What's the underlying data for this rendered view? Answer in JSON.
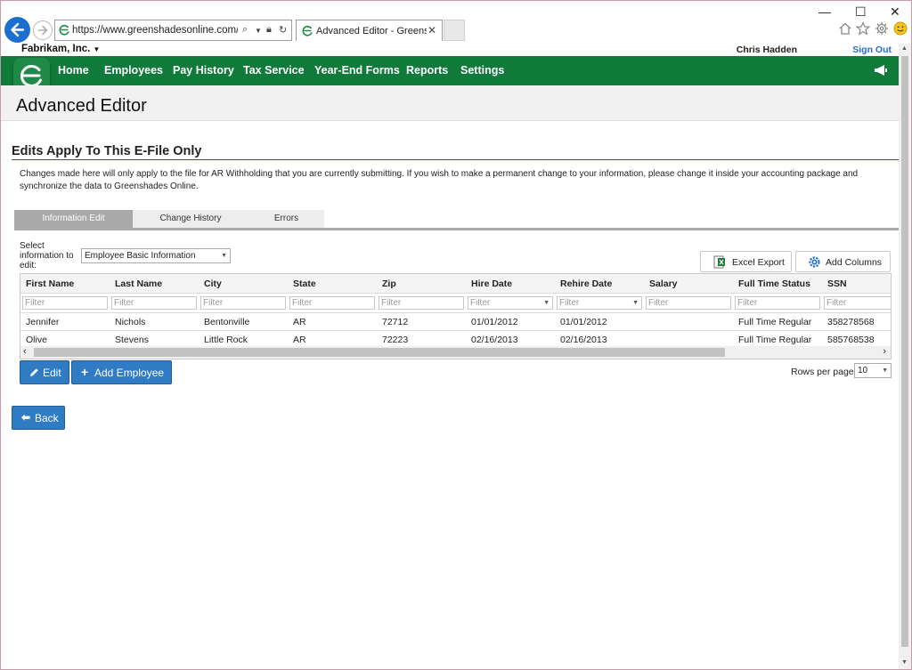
{
  "browser": {
    "url": "https://www.greenshadesonline.com/FileF",
    "tab_title": "Advanced Editor - Greensh...",
    "tab_close": "✕",
    "window_controls": [
      "—",
      "☐",
      "✕"
    ],
    "toolbar_icons": [
      "home-icon",
      "star-icon",
      "gear-icon",
      "smiley-icon"
    ]
  },
  "account": {
    "company": "Fabrikam, Inc.",
    "user": "Chris Hadden",
    "sign_out": "Sign Out"
  },
  "nav": {
    "items": [
      "Home",
      "Employees",
      "Pay History",
      "Tax Service",
      "Year-End Forms",
      "Reports",
      "Settings"
    ]
  },
  "page": {
    "title": "Advanced Editor",
    "section_title": "Edits Apply To This E-File Only",
    "description": "Changes made here will only apply to the file for AR Withholding that you are currently submitting. If you wish to make a permanent change to your information, please change it inside your accounting package and synchronize the data to Greenshades Online."
  },
  "tabs": [
    {
      "label": "Information Edit",
      "active": true
    },
    {
      "label": "Change History",
      "active": false
    },
    {
      "label": "Errors",
      "active": false
    }
  ],
  "selector": {
    "label": "Select information to edit:",
    "value": "Employee Basic Information"
  },
  "toolbar": {
    "excel_export": "Excel Export",
    "add_columns": "Add Columns"
  },
  "grid": {
    "columns": [
      "First Name",
      "Last Name",
      "City",
      "State",
      "Zip",
      "Hire Date",
      "Rehire Date",
      "Salary",
      "Full Time Status",
      "SSN"
    ],
    "filter_placeholder": "Filter",
    "rows": [
      [
        "Jennifer",
        "Nichols",
        "Bentonville",
        "AR",
        "72712",
        "01/01/2012",
        "01/01/2012",
        "",
        "Full Time Regular",
        "358278568"
      ],
      [
        "Olive",
        "Stevens",
        "Little Rock",
        "AR",
        "72223",
        "02/16/2013",
        "02/16/2013",
        "",
        "Full Time Regular",
        "585768538"
      ]
    ]
  },
  "actions": {
    "edit": "Edit",
    "add_employee": "Add Employee",
    "back": "Back"
  },
  "pagination": {
    "rows_per_page_label": "Rows per page:",
    "rows_per_page_value": "10"
  },
  "colors": {
    "brand_green": "#0f7a3a",
    "button_blue": "#2f7cc4",
    "link_blue": "#1c6fd1"
  }
}
